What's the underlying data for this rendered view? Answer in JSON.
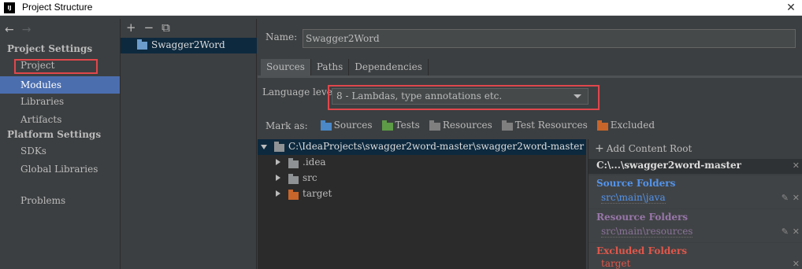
{
  "window": {
    "app_icon_text": "IJ",
    "title": "Project Structure",
    "close_icon": "close-icon"
  },
  "nav": {
    "back_icon": "←",
    "forward_icon": "→",
    "project_settings_header": "Project Settings",
    "project_items": [
      "Project",
      "Modules",
      "Libraries",
      "Artifacts"
    ],
    "platform_settings_header": "Platform Settings",
    "platform_items": [
      "SDKs",
      "Global Libraries"
    ],
    "problems": "Problems",
    "selected": "Modules"
  },
  "modules": {
    "toolbar": {
      "add": "+",
      "remove": "−",
      "copy": "⧉"
    },
    "items": [
      "Swagger2Word"
    ]
  },
  "module_detail": {
    "name_label": "Name:",
    "name_value": "Swagger2Word",
    "tabs": [
      "Sources",
      "Paths",
      "Dependencies"
    ],
    "active_tab": "Sources",
    "language_level_label": "Language level:",
    "language_level_value": "8 - Lambdas, type annotations etc.",
    "mark_as_label": "Mark as:",
    "mark_as": [
      {
        "label": "Sources",
        "color": "#4a88c7"
      },
      {
        "label": "Tests",
        "color": "#5d9b47"
      },
      {
        "label": "Resources",
        "color": "#7f7f7f"
      },
      {
        "label": "Test Resources",
        "color": "#7f7f7f"
      },
      {
        "label": "Excluded",
        "color": "#c7652b"
      }
    ]
  },
  "tree": {
    "root": "C:\\IdeaProjects\\swagger2word-master\\swagger2word-master",
    "children": [
      {
        "label": ".idea",
        "kind": "folder-grey"
      },
      {
        "label": "src",
        "kind": "folder-grey"
      },
      {
        "label": "target",
        "kind": "folder-orange"
      }
    ]
  },
  "content_roots": {
    "add_label": "Add Content Root",
    "root_path": "C:\\...\\swagger2word-master",
    "source_folders_title": "Source Folders",
    "source_folders_color": "#5394ec",
    "source_path": "src\\main\\java",
    "resource_folders_title": "Resource Folders",
    "resource_folders_color": "#9876aa",
    "resource_path": "src\\main\\resources",
    "excluded_folders_title": "Excluded Folders",
    "excluded_folders_color": "#e0574b",
    "excluded_path": "target"
  }
}
